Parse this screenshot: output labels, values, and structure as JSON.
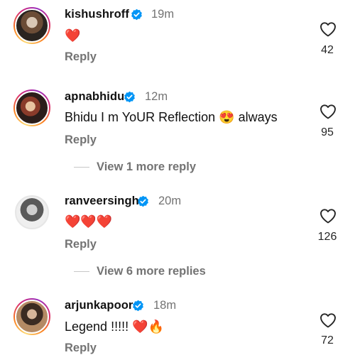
{
  "comments": [
    {
      "username": "kishushroff",
      "time": "19m",
      "text": "",
      "emoji": "❤️",
      "reply_label": "Reply",
      "likes": "42"
    },
    {
      "username": "apnabhidu",
      "time": "12m",
      "text": "Bhidu I m YoUR Reflection",
      "emoji_inline": "😍",
      "text_after": "always",
      "reply_label": "Reply",
      "likes": "95",
      "more_replies": "View 1 more reply"
    },
    {
      "username": "ranveersingh",
      "time": "20m",
      "text": "",
      "emoji": "❤️❤️❤️",
      "reply_label": "Reply",
      "likes": "126",
      "more_replies": "View 6 more replies"
    },
    {
      "username": "arjunkapoor",
      "time": "18m",
      "text": "Legend !!!!!",
      "emoji": "❤️🔥",
      "reply_label": "Reply",
      "likes": "72"
    }
  ],
  "icons": {
    "verified": "verified-badge-icon",
    "like": "heart-outline-icon"
  },
  "colors": {
    "verified_blue": "#0095f6",
    "heart_red": "#e0242b",
    "muted_text": "#737373"
  }
}
